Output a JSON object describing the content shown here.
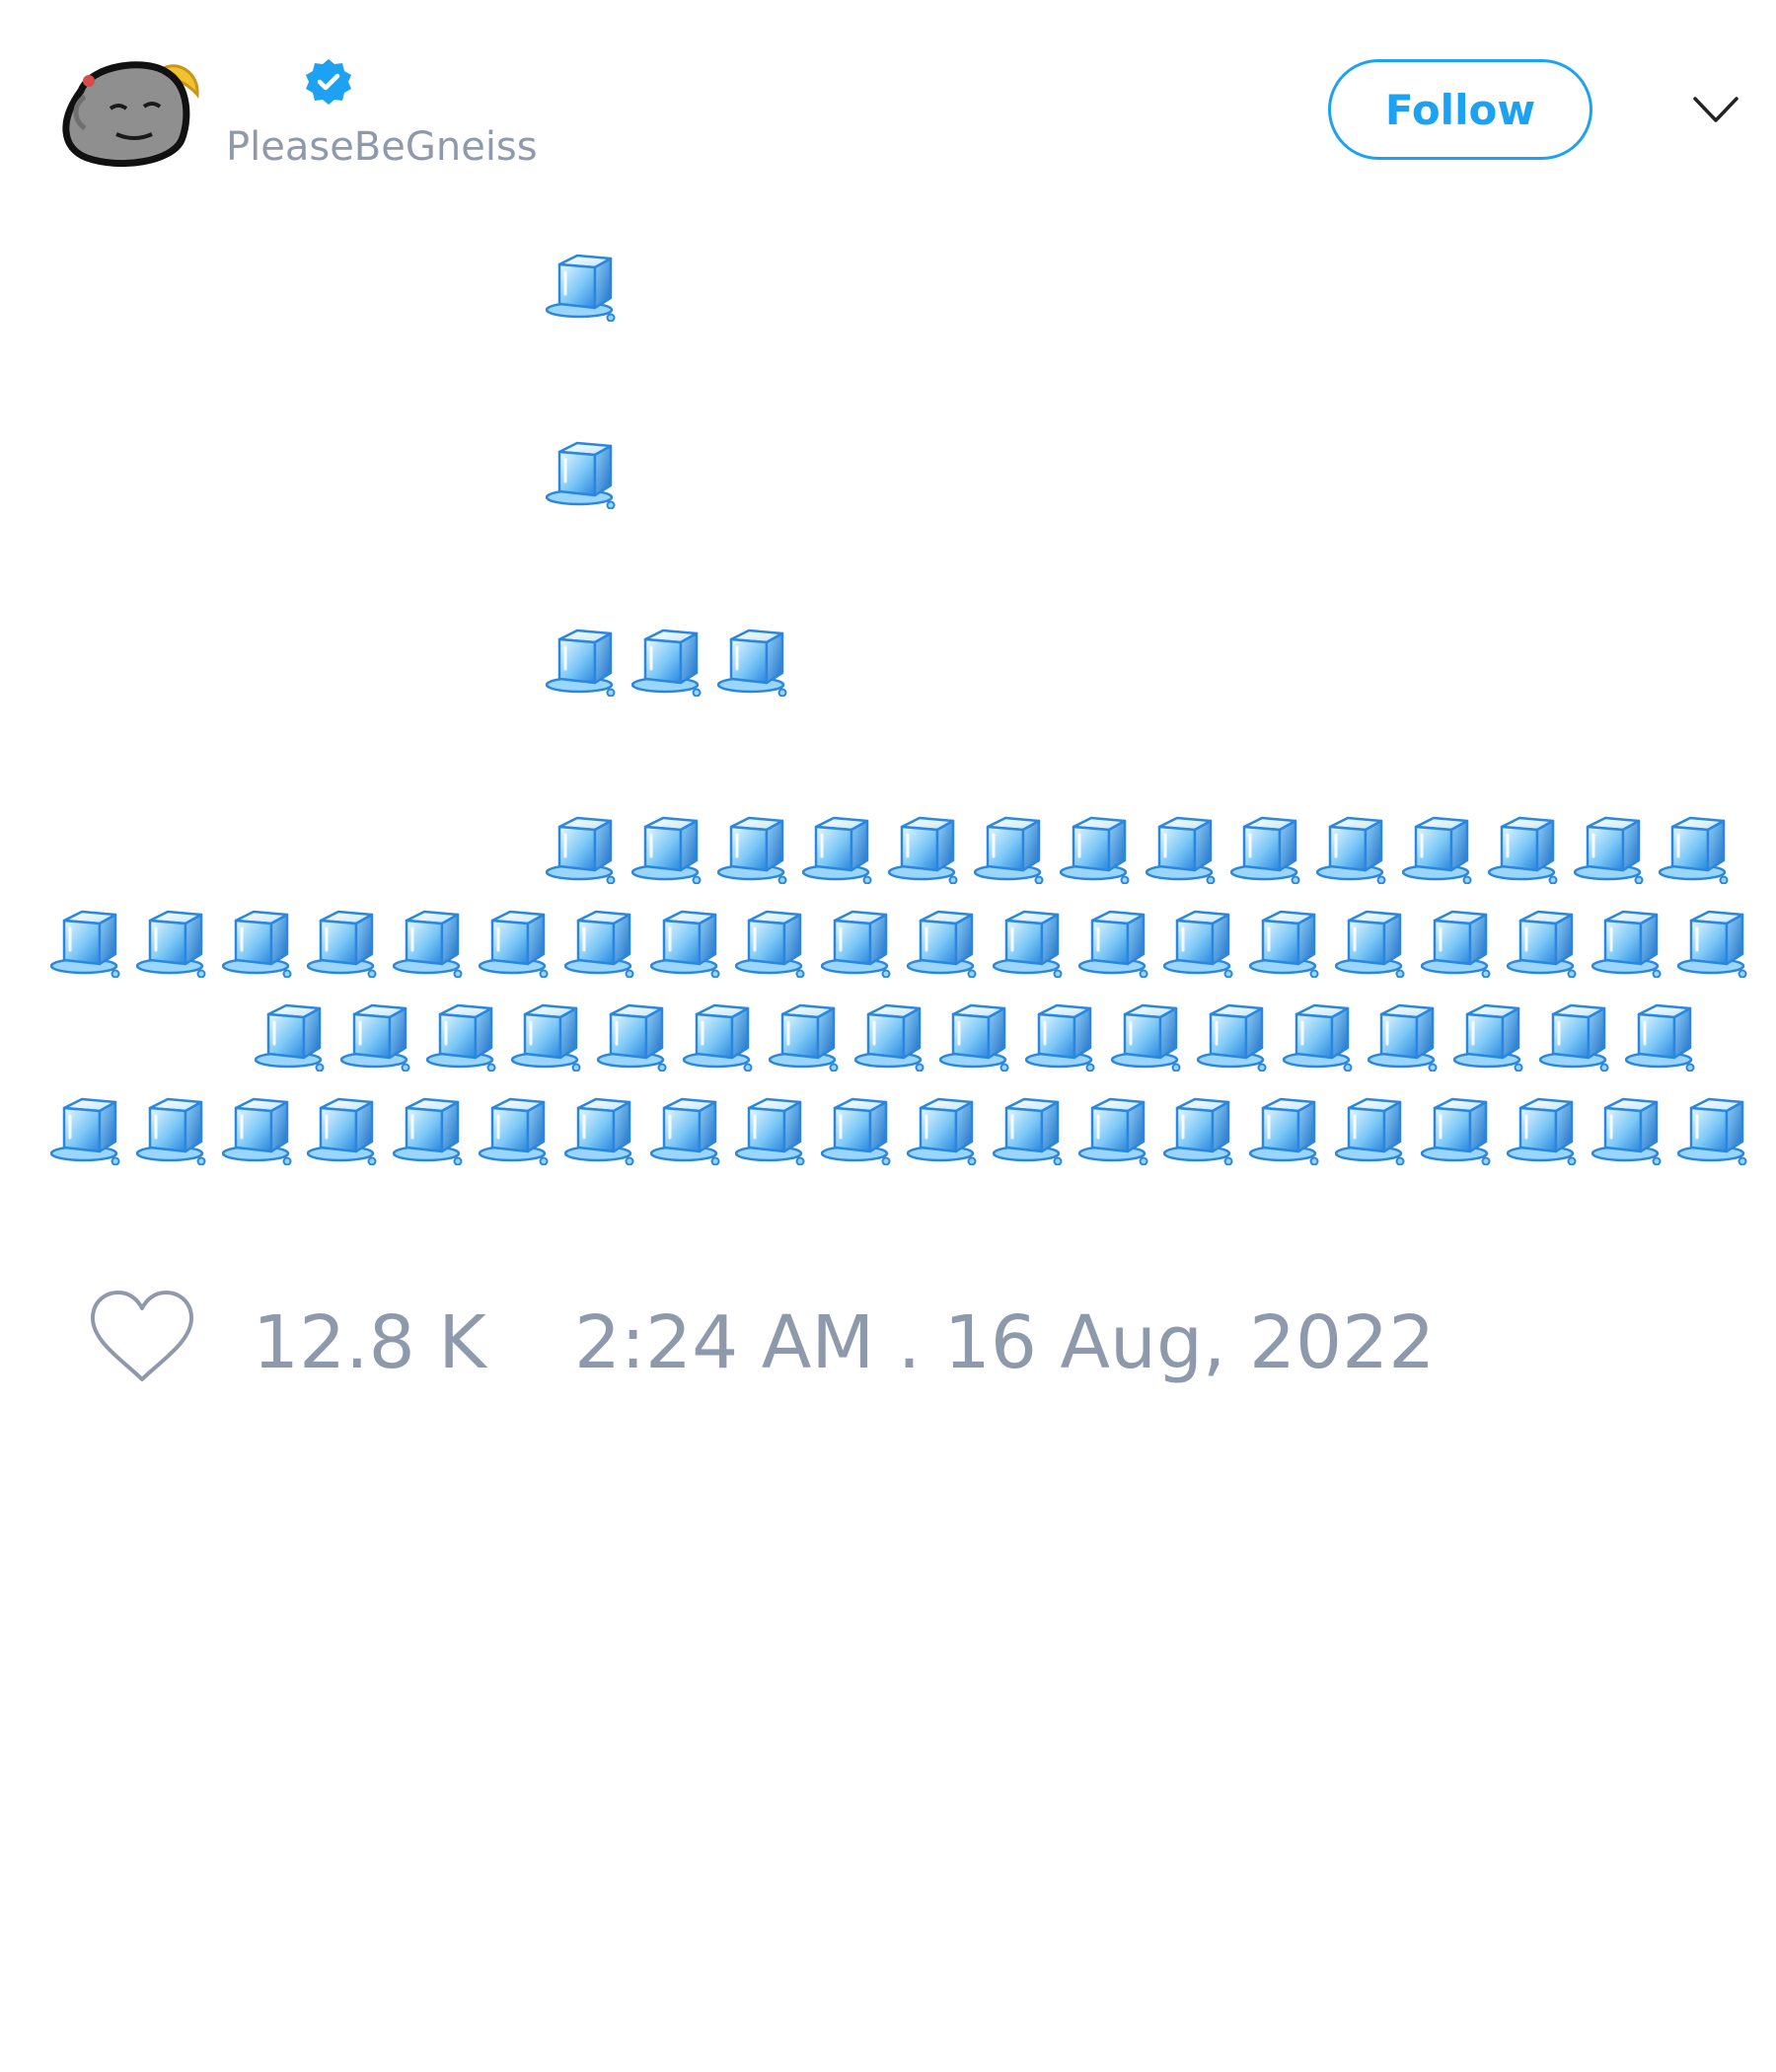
{
  "author": {
    "name": "",
    "handle": "PleaseBeGneiss",
    "verified": true,
    "avatar_icon": "gray-rock-face-with-halo-icon"
  },
  "follow_button": {
    "label": "Follow"
  },
  "menu": {
    "icon": "chevron-down-icon"
  },
  "tweet": {
    "emoji": "🧊",
    "emoji_icon": "ice-cube-icon",
    "line_counts": [
      1,
      1,
      3,
      14,
      20,
      17,
      20
    ]
  },
  "engagement": {
    "like_icon": "heart-outline-icon",
    "likes": "12.8 K",
    "timestamp": "2:24 AM . 16 Aug, 2022"
  },
  "colors": {
    "accent": "#1da1f2",
    "muted_text": "#8e9aab",
    "ice_light": "#dff4ff",
    "ice_dark": "#2f8fe6"
  }
}
